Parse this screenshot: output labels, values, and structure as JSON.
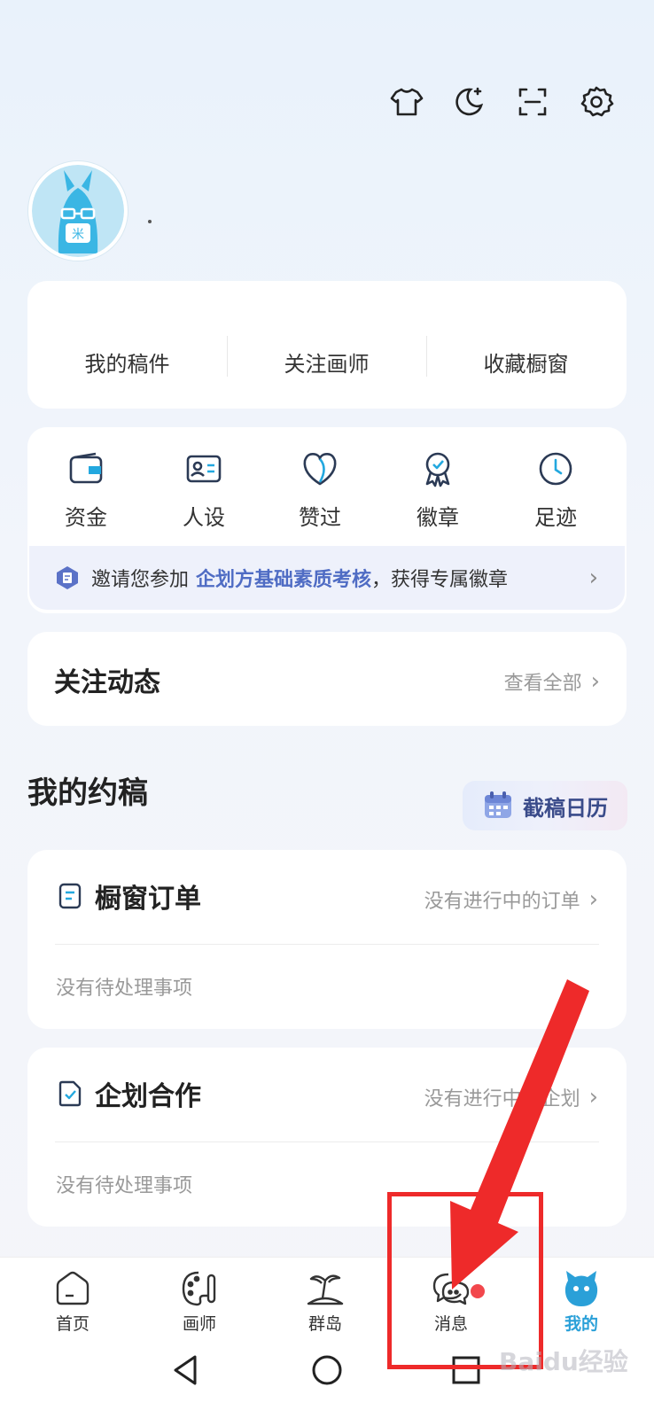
{
  "top_icons": [
    "tshirt-icon",
    "moon-icon",
    "scan-icon",
    "gear-icon"
  ],
  "profile": {
    "name": "."
  },
  "stats": [
    "我的稿件",
    "关注画师",
    "收藏橱窗"
  ],
  "tools": [
    {
      "label": "资金",
      "icon": "wallet-icon"
    },
    {
      "label": "人设",
      "icon": "id-card-icon"
    },
    {
      "label": "赞过",
      "icon": "heart-icon"
    },
    {
      "label": "徽章",
      "icon": "badge-icon"
    },
    {
      "label": "足迹",
      "icon": "clock-icon"
    }
  ],
  "invite": {
    "prefix": "邀请您参加",
    "highlight": "企划方基础素质考核",
    "suffix": "，获得专属徽章"
  },
  "feed": {
    "title": "关注动态",
    "link": "查看全部"
  },
  "orders_section": {
    "title": "我的约稿",
    "calendar_button": "截稿日历"
  },
  "order_card": {
    "title": "橱窗订单",
    "status": "没有进行中的订单",
    "note": "没有待处理事项"
  },
  "coop_card": {
    "title": "企划合作",
    "status": "没有进行中的企划",
    "note": "没有待处理事项"
  },
  "bottom_nav": [
    {
      "label": "首页",
      "icon": "home-icon"
    },
    {
      "label": "画师",
      "icon": "palette-icon"
    },
    {
      "label": "群岛",
      "icon": "island-icon"
    },
    {
      "label": "消息",
      "icon": "chat-icon",
      "badge": true
    },
    {
      "label": "我的",
      "icon": "mascot-icon",
      "active": true
    }
  ],
  "watermark": "Baidu经验",
  "colors": {
    "accent": "#2aa0d8",
    "highlight": "#4f6cc4",
    "annotation": "#ee2a2a"
  }
}
